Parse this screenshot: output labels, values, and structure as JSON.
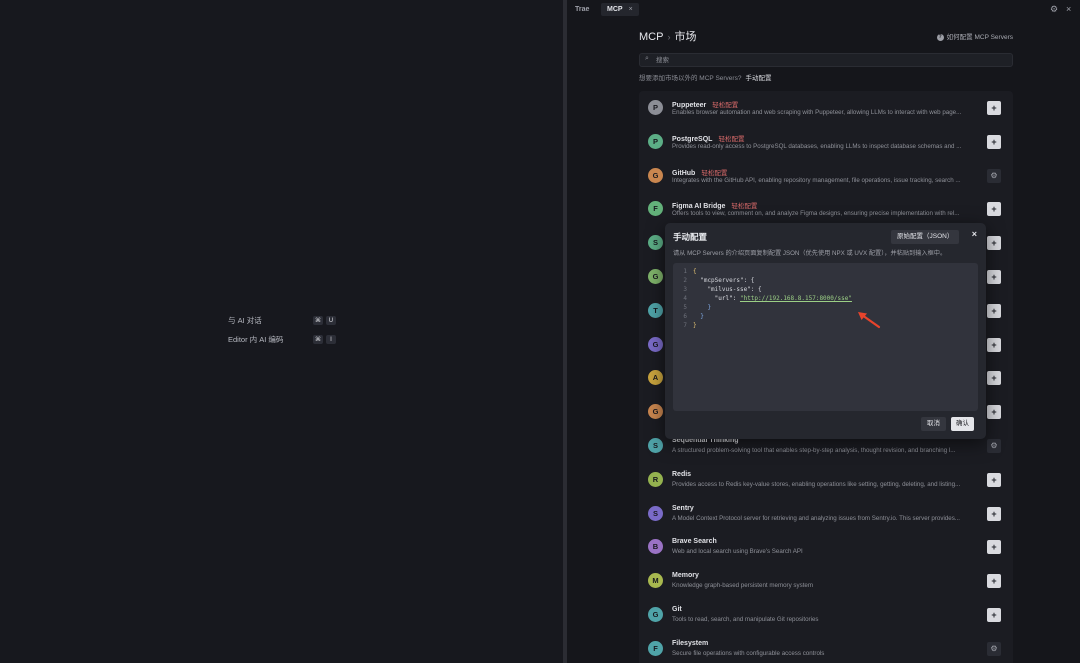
{
  "left_pane": {
    "shortcuts": [
      {
        "label": "与 AI 对话",
        "keys": [
          "⌘",
          "U"
        ]
      },
      {
        "label": "Editor 内 AI 编码",
        "keys": [
          "⌘",
          "I"
        ]
      }
    ]
  },
  "tabs": [
    {
      "label": "Trae"
    },
    {
      "label": "MCP",
      "close": "×"
    }
  ],
  "window_icons": {
    "settings": "gear-icon",
    "close": "×"
  },
  "header": {
    "title_main": "MCP",
    "title_sep": "›",
    "title_sub": "市场",
    "help_icon": "?",
    "help_text": "如何配置 MCP Servers"
  },
  "search": {
    "icon": "⌕",
    "placeholder": "搜索"
  },
  "hint": {
    "text": "想要添加市场以外的 MCP Servers?",
    "link": "手动配置"
  },
  "servers": [
    {
      "letter": "P",
      "color": "#8c8e96",
      "name": "Puppeteer",
      "tag": "轻松配置",
      "desc": "Enables browser automation and web scraping with Puppeteer, allowing LLMs to interact with web page...",
      "action": "+"
    },
    {
      "letter": "P",
      "color": "#5cae86",
      "name": "PostgreSQL",
      "tag": "轻松配置",
      "desc": "Provides read-only access to PostgreSQL databases, enabling LLMs to inspect database schemas and ...",
      "action": "+"
    },
    {
      "letter": "G",
      "color": "#c9864f",
      "name": "GitHub",
      "tag": "轻松配置",
      "desc": "Integrates with the GitHub API, enabling repository management, file operations, issue tracking, search ...",
      "action": "⚙"
    },
    {
      "letter": "F",
      "color": "#63b17a",
      "name": "Figma AI Bridge",
      "tag": "轻松配置",
      "desc": "Offers tools to view, comment on, and analyze Figma designs, ensuring precise implementation with rel...",
      "action": "+"
    },
    {
      "letter": "S",
      "color": "#5cae86",
      "name": "",
      "tag": "",
      "desc": "",
      "action": "+"
    },
    {
      "letter": "G",
      "color": "#7fb36a",
      "name": "",
      "tag": "",
      "desc": "",
      "action": "+"
    },
    {
      "letter": "T",
      "color": "#4fa3a8",
      "name": "",
      "tag": "",
      "desc": "",
      "action": "+"
    },
    {
      "letter": "G",
      "color": "#7a6bc8",
      "name": "",
      "tag": "",
      "desc": "",
      "action": "+"
    },
    {
      "letter": "A",
      "color": "#c9a43e",
      "name": "",
      "tag": "",
      "desc": "",
      "action": "+"
    },
    {
      "letter": "G",
      "color": "#c9864f",
      "name": "",
      "tag": "",
      "desc": "",
      "action": "+"
    },
    {
      "letter": "S",
      "color": "#4fa3a8",
      "name": "Sequential Thinking",
      "tag": "",
      "desc": "A structured problem-solving tool that enables step-by-step analysis, thought revision, and branching l...",
      "action": "⚙"
    },
    {
      "letter": "R",
      "color": "#94b24f",
      "name": "Redis",
      "tag": "",
      "desc": "Provides access to Redis key-value stores, enabling operations like setting, getting, deleting, and listing...",
      "action": "+"
    },
    {
      "letter": "S",
      "color": "#7a6bc8",
      "name": "Sentry",
      "tag": "",
      "desc": "A Model Context Protocol server for retrieving and analyzing issues from Sentry.io. This server provides...",
      "action": "+"
    },
    {
      "letter": "B",
      "color": "#9a72c4",
      "name": "Brave Search",
      "tag": "",
      "desc": "Web and local search using Brave's Search API",
      "action": "+"
    },
    {
      "letter": "M",
      "color": "#a8b84f",
      "name": "Memory",
      "tag": "",
      "desc": "Knowledge graph-based persistent memory system",
      "action": "+"
    },
    {
      "letter": "G",
      "color": "#4fa3a8",
      "name": "Git",
      "tag": "",
      "desc": "Tools to read, search, and manipulate Git repositories",
      "action": "+"
    },
    {
      "letter": "F",
      "color": "#4fa3a8",
      "name": "Filesystem",
      "tag": "",
      "desc": "Secure file operations with configurable access controls",
      "action": "⚙"
    }
  ],
  "modal": {
    "title": "手动配置",
    "raw_button": "原始配置（JSON）",
    "close": "×",
    "description": "请从 MCP Servers 的介绍页面复制配置 JSON（优先使用 NPX 或 UVX 配置），并粘贴到输入框中。",
    "code_lines": [
      {
        "n": "1",
        "text": "{"
      },
      {
        "n": "2",
        "text": "  \"mcpServers\": {"
      },
      {
        "n": "3",
        "text": "    \"milvus-sse\": {"
      },
      {
        "n": "4",
        "text": "      \"url\": \"http://192.168.8.157:8000/sse\""
      },
      {
        "n": "5",
        "text": "    }"
      },
      {
        "n": "6",
        "text": "  }"
      },
      {
        "n": "7",
        "text": "}"
      }
    ],
    "cancel": "取消",
    "confirm": "确认"
  }
}
